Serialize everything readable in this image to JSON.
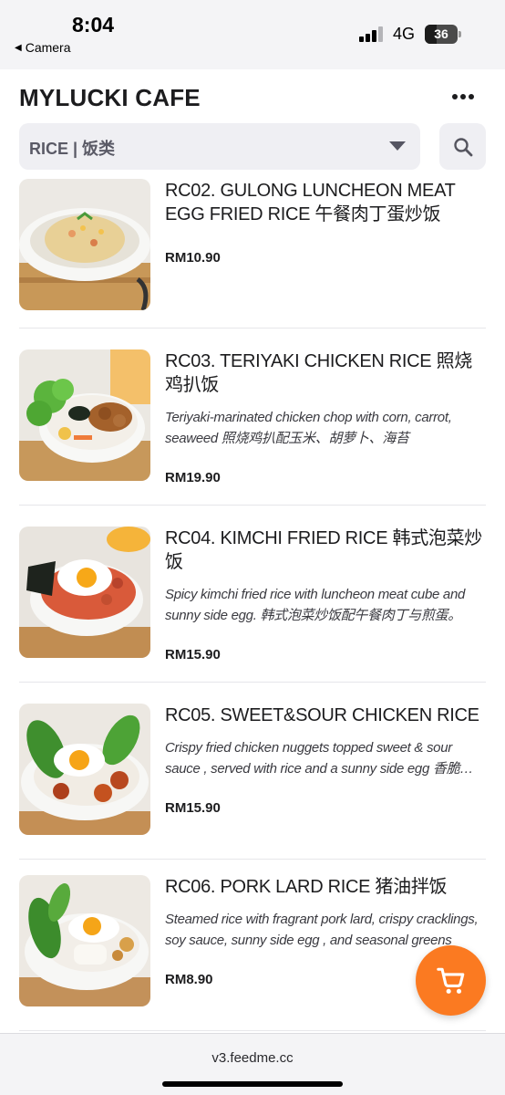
{
  "status_bar": {
    "time": "8:04",
    "back_label": "Camera",
    "network": "4G",
    "battery": "36",
    "battery_level": 0.36
  },
  "header": {
    "title": "MYLUCKI CAFE",
    "category_select": {
      "value": "RICE | 饭类"
    },
    "icons": {
      "more": "more-horizontal-icon",
      "search": "search-icon",
      "dropdown": "caret-down-icon"
    }
  },
  "menu": {
    "items": [
      {
        "name": "RC02. GULONG LUNCHEON MEAT EGG FRIED RICE 午餐肉丁蛋炒饭",
        "description": "",
        "price": "RM10.90"
      },
      {
        "name": "RC03. TERIYAKI CHICKEN RICE 照烧鸡扒饭",
        "description": "Teriyaki-marinated chicken chop with corn, carrot, seaweed 照烧鸡扒配玉米、胡萝卜、海苔",
        "price": "RM19.90"
      },
      {
        "name": "RC04. KIMCHI FRIED RICE 韩式泡菜炒饭",
        "description": "Spicy kimchi fried rice with luncheon meat cube and sunny side egg. 韩式泡菜炒饭配午餐肉丁与煎蛋。",
        "price": "RM15.90"
      },
      {
        "name": "RC05. SWEET&SOUR CHICKEN RICE",
        "description": "Crispy fried chicken nuggets topped sweet & sour sauce , served with rice and a sunny side egg 香脆炸鸡块淋上酸甜酱，配白饭与煎蛋",
        "price": "RM15.90"
      },
      {
        "name": "RC06. PORK LARD RICE 猪油拌饭",
        "description": "Steamed rice with fragrant pork lard, crispy cracklings, soy sauce, sunny side egg , and seasonal greens",
        "price": "RM8.90"
      }
    ]
  },
  "cart": {
    "icon": "shopping-cart-icon"
  },
  "footer": {
    "url": "v3.feedme.cc"
  },
  "colors": {
    "accent": "#fb7a21",
    "select_bg": "#efeff3",
    "text": "#1c1c1e"
  }
}
